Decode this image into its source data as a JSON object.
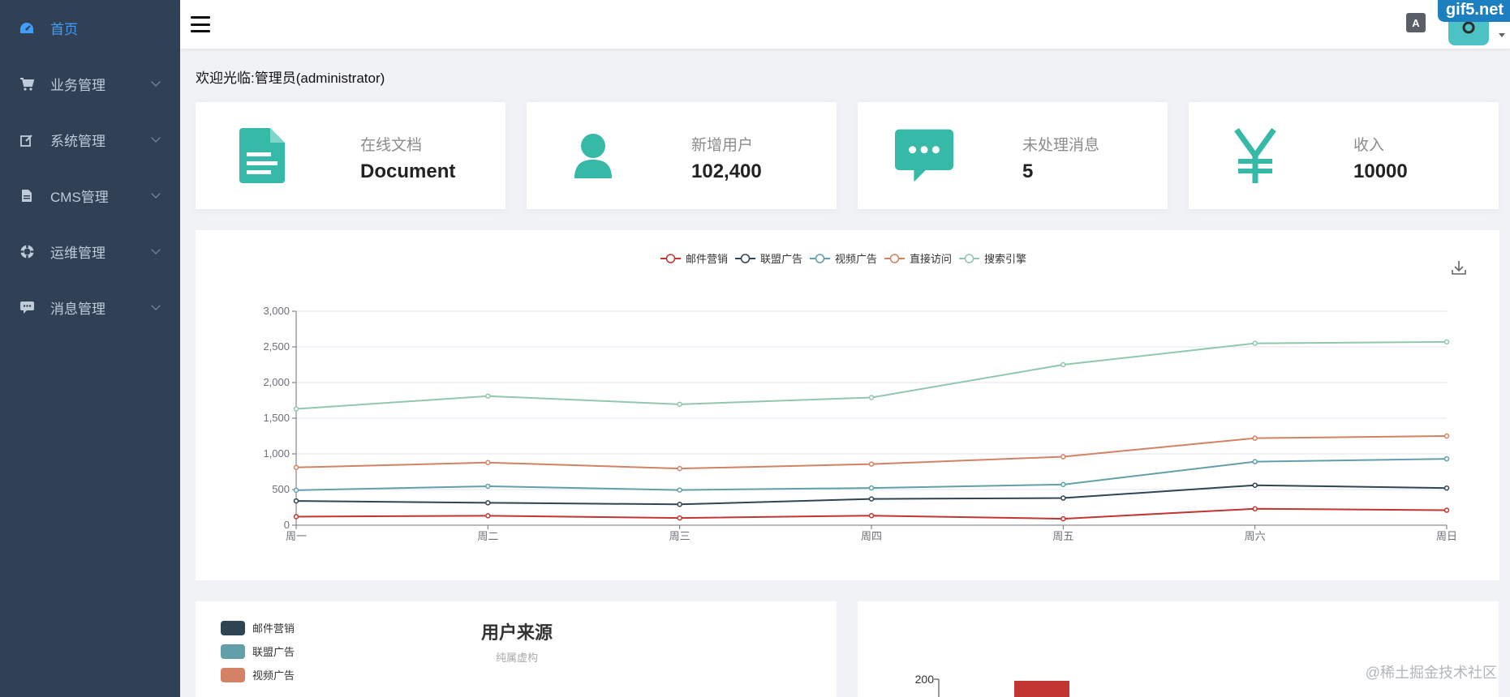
{
  "sidebar": {
    "items": [
      {
        "label": "首页",
        "icon": "dashboard-icon",
        "active": true,
        "has_children": false
      },
      {
        "label": "业务管理",
        "icon": "cart-icon",
        "active": false,
        "has_children": true
      },
      {
        "label": "系统管理",
        "icon": "edit-icon",
        "active": false,
        "has_children": true
      },
      {
        "label": "CMS管理",
        "icon": "document-icon",
        "active": false,
        "has_children": true
      },
      {
        "label": "运维管理",
        "icon": "lifebuoy-icon",
        "active": false,
        "has_children": true
      },
      {
        "label": "消息管理",
        "icon": "message-icon",
        "active": false,
        "has_children": true
      }
    ]
  },
  "navbar": {
    "lang_label": "A",
    "watermark": "gif5.net"
  },
  "welcome": "欢迎光临:管理员(administrator)",
  "stats": [
    {
      "label": "在线文档",
      "value": "Document",
      "icon": "document-icon"
    },
    {
      "label": "新增用户",
      "value": "102,400",
      "icon": "user-icon"
    },
    {
      "label": "未处理消息",
      "value": "5",
      "icon": "message-icon"
    },
    {
      "label": "收入",
      "value": "10000",
      "icon": "yen-icon"
    }
  ],
  "colors": {
    "accent": "#36b9a6",
    "sidebar_bg": "#304156",
    "sidebar_text": "#bfcbd9",
    "sidebar_active": "#409eff"
  },
  "chart_data": [
    {
      "type": "line",
      "categories": [
        "周一",
        "周二",
        "周三",
        "周四",
        "周五",
        "周六",
        "周日"
      ],
      "ylim": [
        0,
        3000
      ],
      "yticks": [
        0,
        500,
        1000,
        1500,
        2000,
        2500,
        3000
      ],
      "ytick_labels": [
        "0",
        "500",
        "1,000",
        "1,500",
        "2,000",
        "2,500",
        "3,000"
      ],
      "legend_position": "top-center",
      "grid": true,
      "series": [
        {
          "name": "邮件营销",
          "color": "#c23531",
          "values": [
            120,
            132,
            101,
            134,
            90,
            230,
            210
          ]
        },
        {
          "name": "联盟广告",
          "color": "#2f4554",
          "values": [
            220,
            182,
            191,
            234,
            290,
            330,
            310
          ]
        },
        {
          "name": "视频广告",
          "color": "#61a0a8",
          "values": [
            150,
            232,
            201,
            154,
            190,
            330,
            410
          ]
        },
        {
          "name": "直接访问",
          "color": "#d48265",
          "values": [
            320,
            332,
            301,
            334,
            390,
            330,
            320
          ]
        },
        {
          "name": "搜索引擎",
          "color": "#91c7ae",
          "values": [
            820,
            932,
            901,
            934,
            1290,
            1330,
            1320
          ]
        }
      ],
      "stacked": true
    },
    {
      "type": "pie",
      "title": "用户来源",
      "subtitle": "纯属虚构",
      "legend_position": "top-left",
      "legend": [
        {
          "name": "邮件营销",
          "color": "#2f4554"
        },
        {
          "name": "联盟广告",
          "color": "#61a0a8"
        },
        {
          "name": "视频广告",
          "color": "#d48265"
        }
      ]
    },
    {
      "type": "bar",
      "ytick_labels": [
        "200"
      ],
      "bar_color": "#c23531"
    }
  ],
  "corner_watermark": "@稀土掘金技术社区"
}
